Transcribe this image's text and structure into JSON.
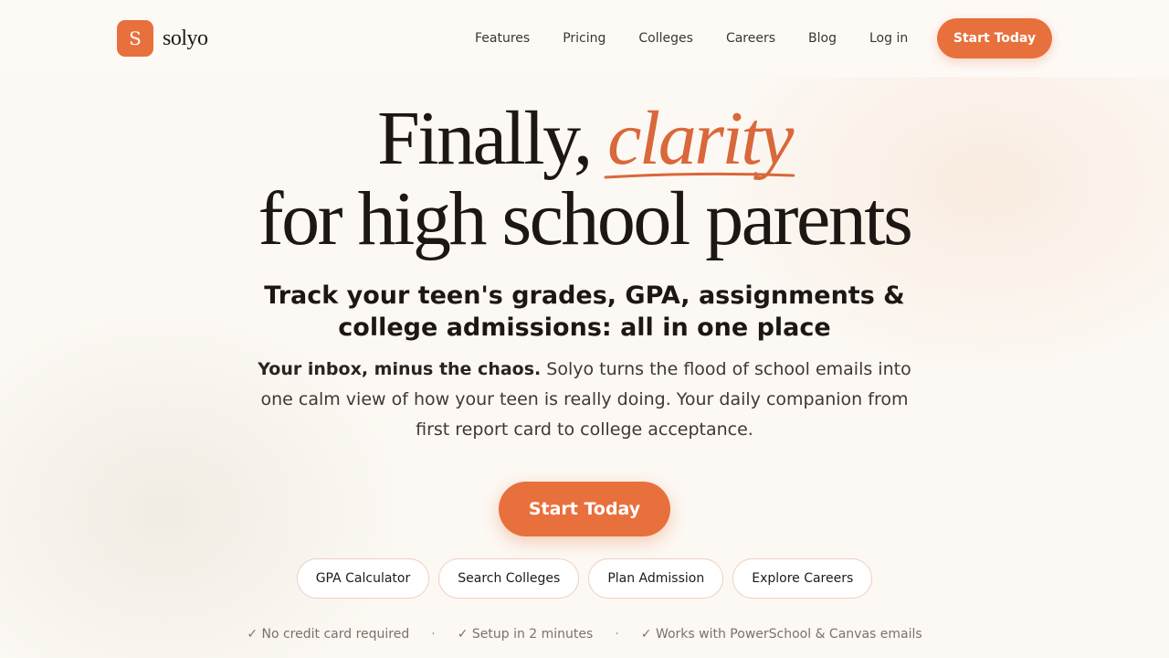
{
  "brand": {
    "logo_letter": "S",
    "name": "solyo",
    "accent_color": "#e8703c",
    "background_color": "#fcf8f3"
  },
  "nav": {
    "items": [
      {
        "label": "Features"
      },
      {
        "label": "Pricing"
      },
      {
        "label": "Colleges"
      },
      {
        "label": "Careers"
      },
      {
        "label": "Blog"
      },
      {
        "label": "Log in"
      }
    ],
    "cta_label": "Start Today"
  },
  "hero": {
    "title_prefix": "Finally, ",
    "title_accent": "clarity",
    "title_line2": "for high school parents",
    "subhead": "Track your teen's grades, GPA, assignments & college admissions: all in one place",
    "lede_bold": "Your inbox, minus the chaos.",
    "lede_rest": " Solyo turns the flood of school emails into one calm view of how your teen is really doing. Your daily companion from first report card to college acceptance.",
    "cta_label": "Start Today"
  },
  "quick_links": [
    {
      "label": "GPA Calculator"
    },
    {
      "label": "Search Colleges"
    },
    {
      "label": "Plan Admission"
    },
    {
      "label": "Explore Careers"
    }
  ],
  "trust": {
    "items": [
      {
        "label": "✓ No credit card required"
      },
      {
        "label": "✓ Setup in 2 minutes"
      },
      {
        "label": "✓ Works with PowerSchool & Canvas emails"
      }
    ],
    "separator": "·"
  }
}
